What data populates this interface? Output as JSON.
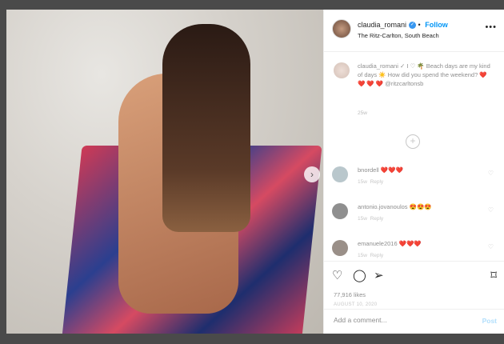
{
  "post": {
    "username": "claudia_romani",
    "follow_label": "Follow",
    "location": "The Ritz-Carlton, South Beach",
    "more_icon": "more-horizontal-icon"
  },
  "caption": {
    "text": "claudia_romani ✓ I ♡ 🌴 Beach days are my kind of days ☀️ How did you spend the weekend?",
    "emojis": "❤️ ❤️ ❤️ ❤️",
    "tag": "@ritzcarltonsb",
    "time": "25w"
  },
  "comments": [
    {
      "user": "bnordell",
      "emojis": "❤️❤️❤️",
      "time": "15w",
      "reply": "Reply",
      "avatar_color": "#b9c7cc"
    },
    {
      "user": "antonio.jovanoulos",
      "emojis": "😍😍😍",
      "time": "15w",
      "reply": "Reply",
      "avatar_color": "#8f8f8f"
    },
    {
      "user": "emanuele2016",
      "emojis": "❤️❤️❤️",
      "time": "15w",
      "reply": "Reply",
      "avatar_color": "#9a8f88"
    }
  ],
  "actions": {
    "likes": "77,916 likes",
    "date": "AUGUST 10, 2020"
  },
  "add_comment": {
    "placeholder": "Add a comment...",
    "post_label": "Post"
  }
}
